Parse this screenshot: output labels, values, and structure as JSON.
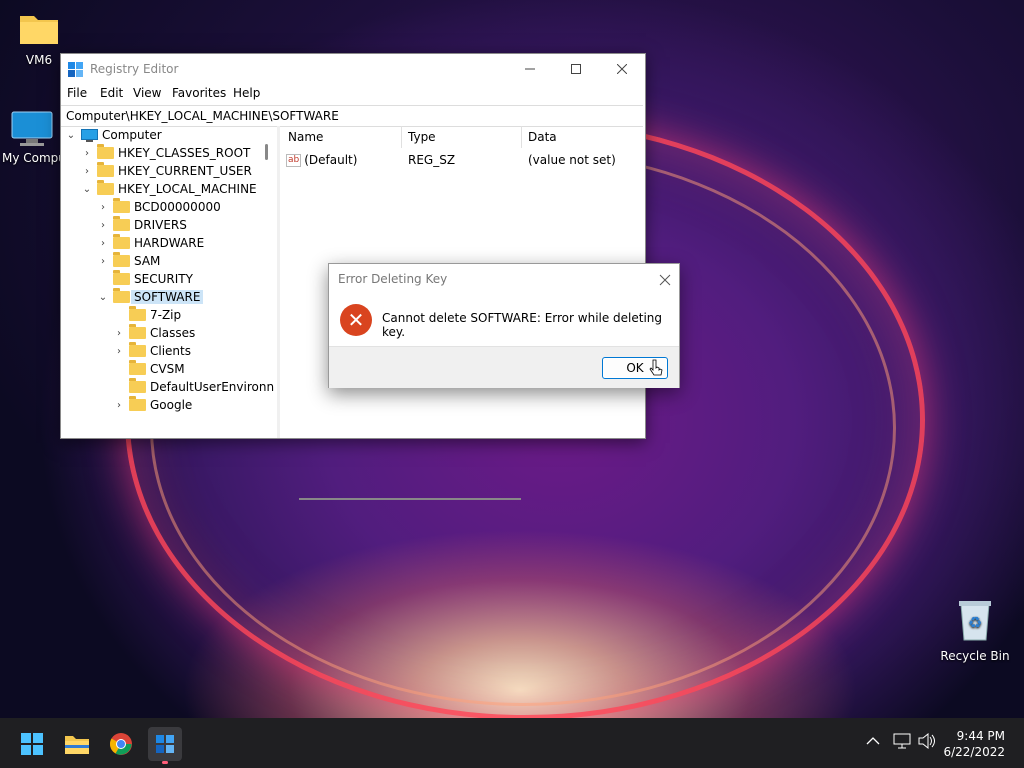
{
  "desktop": {
    "icons": [
      {
        "label": "VM6"
      },
      {
        "label": "My Compu"
      },
      {
        "label": "Recycle Bin"
      }
    ]
  },
  "registry": {
    "title": "Registry Editor",
    "menu": [
      "File",
      "Edit",
      "View",
      "Favorites",
      "Help"
    ],
    "address": "Computer\\HKEY_LOCAL_MACHINE\\SOFTWARE",
    "tree": [
      {
        "label": "Computer"
      },
      {
        "label": "HKEY_CLASSES_ROOT"
      },
      {
        "label": "HKEY_CURRENT_USER"
      },
      {
        "label": "HKEY_LOCAL_MACHINE"
      },
      {
        "label": "BCD00000000"
      },
      {
        "label": "DRIVERS"
      },
      {
        "label": "HARDWARE"
      },
      {
        "label": "SAM"
      },
      {
        "label": "SECURITY"
      },
      {
        "label": "SOFTWARE"
      },
      {
        "label": "7-Zip"
      },
      {
        "label": "Classes"
      },
      {
        "label": "Clients"
      },
      {
        "label": "CVSM"
      },
      {
        "label": "DefaultUserEnvironn"
      },
      {
        "label": "Google"
      }
    ],
    "columns": [
      "Name",
      "Type",
      "Data"
    ],
    "rows": [
      {
        "name": "(Default)",
        "type": "REG_SZ",
        "data": "(value not set)",
        "icon": "ab"
      }
    ]
  },
  "dialog": {
    "title": "Error Deleting Key",
    "message": "Cannot delete SOFTWARE:  Error while deleting key.",
    "ok_label": "OK"
  },
  "taskbar": {
    "time": "9:44 PM",
    "date": "6/22/2022"
  }
}
